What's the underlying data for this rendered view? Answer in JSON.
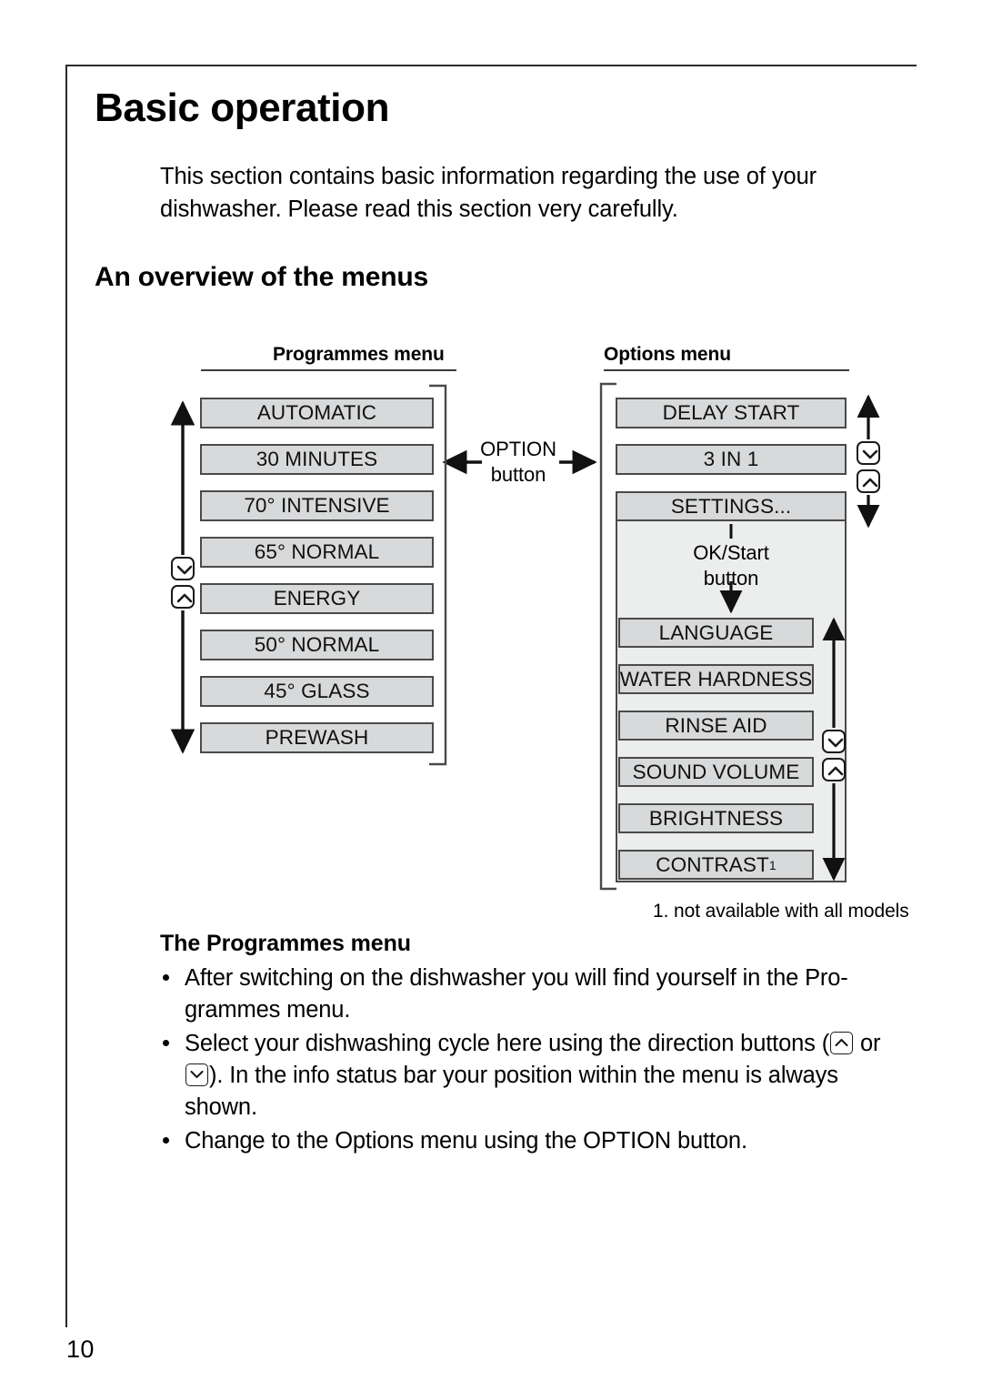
{
  "page": {
    "number": "10",
    "chapter_title": "Basic operation",
    "intro": "This section contains basic information regarding the use of your dishwasher. Please read this section very carefully.",
    "section_title": "An overview of the menus"
  },
  "diagram": {
    "programmes_header": "Programmes menu",
    "options_header": "Options menu",
    "option_button_label_line1": "OPTION",
    "option_button_label_line2": "button",
    "ok_start_label_line1": "OK/Start",
    "ok_start_label_line2": "button",
    "footnote": "1. not available with all models",
    "programmes_items": [
      "AUTOMATIC",
      "30 MINUTES",
      "70° INTENSIVE",
      "65° NORMAL",
      "ENERGY",
      "50° NORMAL",
      "45° GLASS",
      "PREWASH"
    ],
    "options_items": [
      "DELAY START",
      "3 IN 1",
      "SETTINGS..."
    ],
    "settings_items": [
      "LANGUAGE",
      "WATER HARDNESS",
      "RINSE AID",
      "SOUND VOLUME",
      "BRIGHTNESS",
      "CONTRAST"
    ],
    "contrast_footnote_marker": "1",
    "box_fill": "#d8d9da",
    "panel_fill": "#eceeed",
    "stroke": "#4a4a4a"
  },
  "body": {
    "sub_title": "The Programmes menu",
    "bullet1": "After switching on the dishwasher you will find yourself in the Pro-grammes menu.",
    "bullet2_part1": "Select your dishwashing cycle here using the direction buttons (",
    "bullet2_part2": " or",
    "bullet2_part3": "). In the info status bar your position within the menu is always shown.",
    "bullet3": "Change to the Options menu using the OPTION button."
  }
}
